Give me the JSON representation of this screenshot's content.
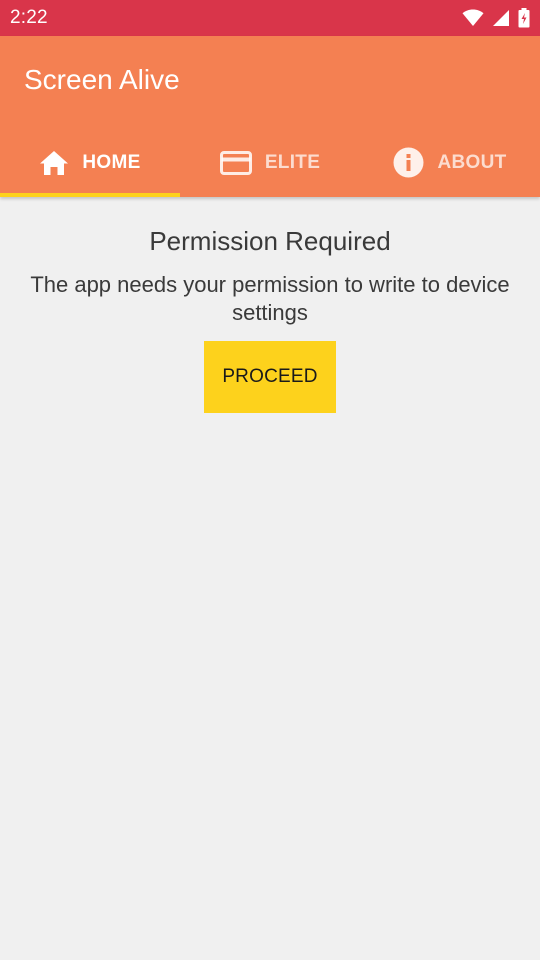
{
  "status_bar": {
    "time": "2:22",
    "icons": [
      "wifi-icon",
      "signal-icon",
      "battery-charging-icon"
    ]
  },
  "app_bar": {
    "title": "Screen Alive",
    "color": "#f48052"
  },
  "tabs": [
    {
      "label": "HOME",
      "icon": "home-icon",
      "selected": true
    },
    {
      "label": "ELITE",
      "icon": "credit-card-icon",
      "selected": false
    },
    {
      "label": "ABOUT",
      "icon": "info-icon",
      "selected": false
    }
  ],
  "main": {
    "title": "Permission Required",
    "message": "The app needs your permission to write to device settings",
    "proceed_label": "PROCEED"
  },
  "colors": {
    "status_bar": "#d9354a",
    "accent": "#fdd21c",
    "background": "#f0f0f0"
  }
}
